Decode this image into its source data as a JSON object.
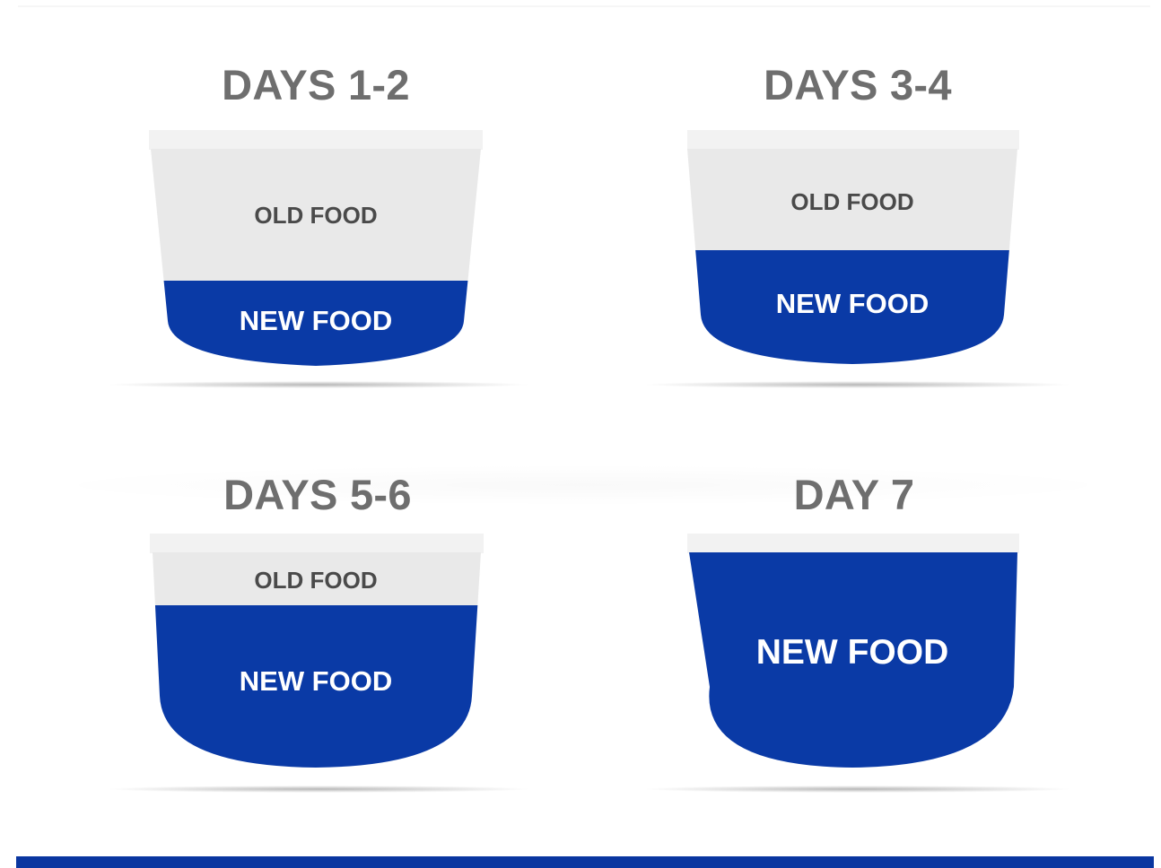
{
  "colors": {
    "new_food": "#0a3aa6",
    "old_food": "#e9e9e9",
    "rim": "#f2f2f2",
    "title_text": "#6e6e6e",
    "old_food_text": "#4a4a4a",
    "bottom_bar": "#0a36a0"
  },
  "panels": [
    {
      "title": "DAYS 1-2",
      "old_label": "OLD FOOD",
      "new_label": "NEW FOOD"
    },
    {
      "title": "DAYS 3-4",
      "old_label": "OLD FOOD",
      "new_label": "NEW FOOD"
    },
    {
      "title": "DAYS 5-6",
      "old_label": "OLD FOOD",
      "new_label": "NEW FOOD"
    },
    {
      "title": "DAY 7",
      "new_label": "NEW FOOD"
    }
  ]
}
